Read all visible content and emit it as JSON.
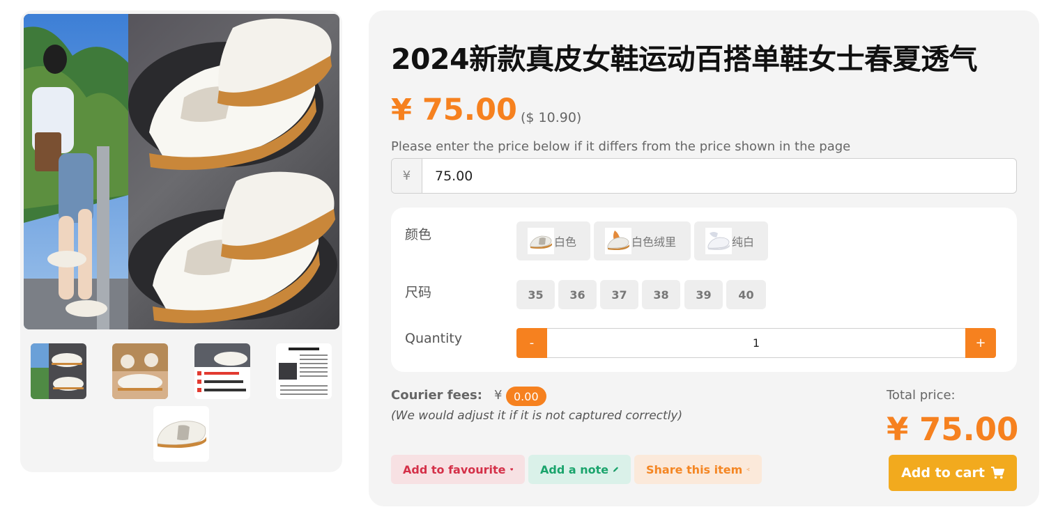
{
  "product": {
    "title": "2024新款真皮女鞋运动百搭单鞋女士春夏透气",
    "price_cny": "¥ 75.00",
    "price_usd": "($ 10.90)",
    "price_hint": "Please enter the price below if it differs from the price shown in the page",
    "price_input": {
      "currency": "¥",
      "value": "75.00"
    }
  },
  "options": {
    "color_label": "颜色",
    "colors": [
      {
        "label": "白色",
        "icon": "white-sneaker-thumb"
      },
      {
        "label": "白色绒里",
        "icon": "fleece-lined-sneaker-thumb"
      },
      {
        "label": "纯白",
        "icon": "pure-white-sneaker-thumb"
      }
    ],
    "size_label": "尺码",
    "sizes": [
      "35",
      "36",
      "37",
      "38",
      "39",
      "40"
    ],
    "quantity_label": "Quantity",
    "quantity": {
      "minus": "-",
      "value": "1",
      "plus": "+"
    }
  },
  "courier": {
    "label": "Courier fees:",
    "currency": "¥",
    "fee": "0.00",
    "note": "(We would adjust it if it is not captured correctly)"
  },
  "total": {
    "label": "Total price:",
    "price": "¥ 75.00"
  },
  "actions": {
    "favourite": "Add to favourite",
    "note": "Add a note",
    "share": "Share this item",
    "cart": "Add to cart"
  },
  "colors": {
    "accent": "#f6811f",
    "cart": "#f2aa1e",
    "favourite": "#d43048",
    "note": "#1aa46c",
    "panel": "#f4f4f4"
  }
}
